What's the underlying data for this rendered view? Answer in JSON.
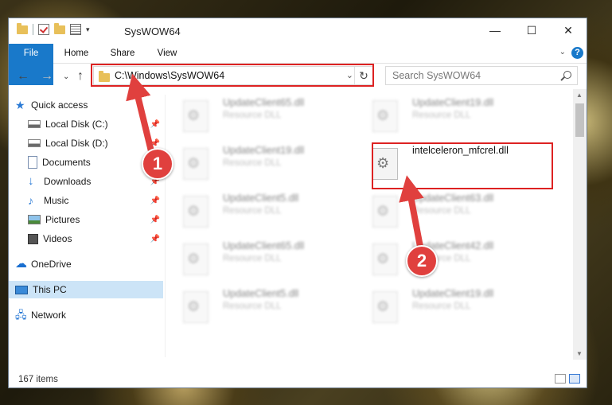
{
  "window": {
    "title": "SysWOW64",
    "controls": {
      "minimize": "—",
      "maximize": "☐",
      "close": "✕"
    }
  },
  "ribbon": {
    "tabs": [
      "File",
      "Home",
      "Share",
      "View"
    ],
    "help": "?"
  },
  "nav": {
    "address": "C:\\Windows\\SysWOW64",
    "search_placeholder": "Search SysWOW64"
  },
  "sidebar": {
    "items": [
      {
        "label": "Quick access",
        "icon": "star-icon"
      },
      {
        "label": "Local Disk (C:)",
        "icon": "drive-icon",
        "pinned": true
      },
      {
        "label": "Local Disk (D:)",
        "icon": "drive-icon",
        "pinned": true
      },
      {
        "label": "Documents",
        "icon": "documents-icon",
        "pinned": true
      },
      {
        "label": "Downloads",
        "icon": "download-icon",
        "pinned": true
      },
      {
        "label": "Music",
        "icon": "music-icon",
        "pinned": true
      },
      {
        "label": "Pictures",
        "icon": "pictures-icon",
        "pinned": true
      },
      {
        "label": "Videos",
        "icon": "videos-icon",
        "pinned": true
      },
      {
        "label": "OneDrive",
        "icon": "cloud-icon"
      },
      {
        "label": "This PC",
        "icon": "computer-icon",
        "selected": true
      },
      {
        "label": "Network",
        "icon": "network-icon"
      }
    ]
  },
  "files": [
    {
      "name": "UpdateClient65.dll",
      "type": "Resource DLL"
    },
    {
      "name": "UpdateClient19.dll",
      "type": "Resource DLL"
    },
    {
      "name": "UpdateClient19.dll",
      "type": "Resource DLL"
    },
    {
      "name": "intelceleron_mfcrel.dll",
      "type": ""
    },
    {
      "name": "UpdateClient5.dll",
      "type": "Resource DLL"
    },
    {
      "name": "UpdateClient63.dll",
      "type": "Resource DLL"
    },
    {
      "name": "UpdateClient65.dll",
      "type": "Resource DLL"
    },
    {
      "name": "UpdateClient42.dll",
      "type": "Resource DLL"
    },
    {
      "name": "UpdateClient5.dll",
      "type": "Resource DLL"
    },
    {
      "name": "UpdateClient19.dll",
      "type": "Resource DLL"
    }
  ],
  "status": {
    "count": "167 items"
  },
  "markers": [
    "1",
    "2"
  ],
  "colors": {
    "accent": "#1979ca",
    "highlight": "#dd2222",
    "marker": "#e0403e"
  }
}
